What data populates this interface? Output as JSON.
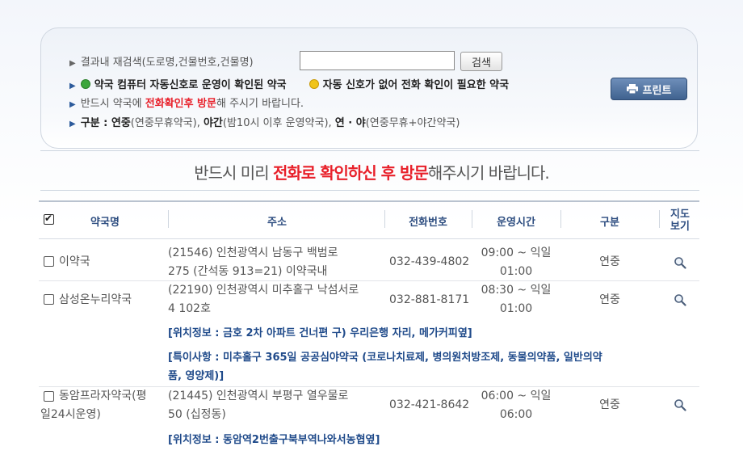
{
  "search": {
    "label": "결과내 재검색(도로명,건물번호,건물명)",
    "input_value": "",
    "button_label": "검색"
  },
  "legend": {
    "green_text": "약국 컴퓨터 자동신호로 운영이 확인된 약국",
    "yellow_text": "자동 신호가 없어 전화 확인이 필요한 약국",
    "notice_pre": "반드시 약국에 ",
    "notice_red": "전화확인후 방문",
    "notice_post": "해 주시기 바랍니다.",
    "category_label": "구분 : ",
    "cat1_bold": "연중",
    "cat1_desc": "(연중무휴약국), ",
    "cat2_bold": "야간",
    "cat2_desc": "(밤10시 이후 운영약국), ",
    "cat3_bold": "연 · 야",
    "cat3_desc": "(연중무휴+야간약국)"
  },
  "print_button": "프린트",
  "notice_banner": {
    "pre": "반드시 미리 ",
    "red": "전화로 확인하신 후 방문",
    "post": "해주시기 바랍니다."
  },
  "table": {
    "headers": {
      "name": "약국명",
      "address": "주소",
      "phone": "전화번호",
      "hours": "운영시간",
      "category": "구분",
      "map_line1": "지도",
      "map_line2": "보기"
    },
    "rows": [
      {
        "name": "이약국",
        "address_line1": "(21546) 인천광역시 남동구 백범로",
        "address_line2": "275 (간석동 913=21) 이약국내",
        "phone": "032-439-4802",
        "hours_line1": "09:00 ~ 익일",
        "hours_line2": "01:00",
        "category": "연중"
      },
      {
        "name": "삼성온누리약국",
        "address_line1": "(22190) 인천광역시 미추홀구 낙섬서로",
        "address_line2": "4 102호",
        "phone": "032-881-8171",
        "hours_line1": "08:30 ~ 익일",
        "hours_line2": "01:00",
        "category": "연중",
        "location_info": "[위치정보 : 금호 2차 아파트 건너편 구) 우리은행 자리, 메가커피옆]",
        "special_line1": "[특이사항 : 미추홀구 365일 공공심야약국 (코로나치료제, 병의원처방조제, 동물의약품, 일반의약",
        "special_line2": "품, 영양제)]"
      },
      {
        "name_line1": "동암프라자약국(평",
        "name_line2": "일24시운영)",
        "address_line1": "(21445) 인천광역시 부평구 열우물로",
        "address_line2": "50 (십정동)",
        "phone": "032-421-8642",
        "hours_line1": "06:00 ~ 익일",
        "hours_line2": "06:00",
        "category": "연중",
        "location_info": "[위치정보 : 동암역2번출구북부역나와서농협옆]"
      }
    ]
  },
  "colors": {
    "accent_blue": "#1f4a8a",
    "notice_red": "#e8202a",
    "status_green": "#3ca63c",
    "status_yellow": "#f0c419",
    "print_button": "#4a6c99"
  }
}
